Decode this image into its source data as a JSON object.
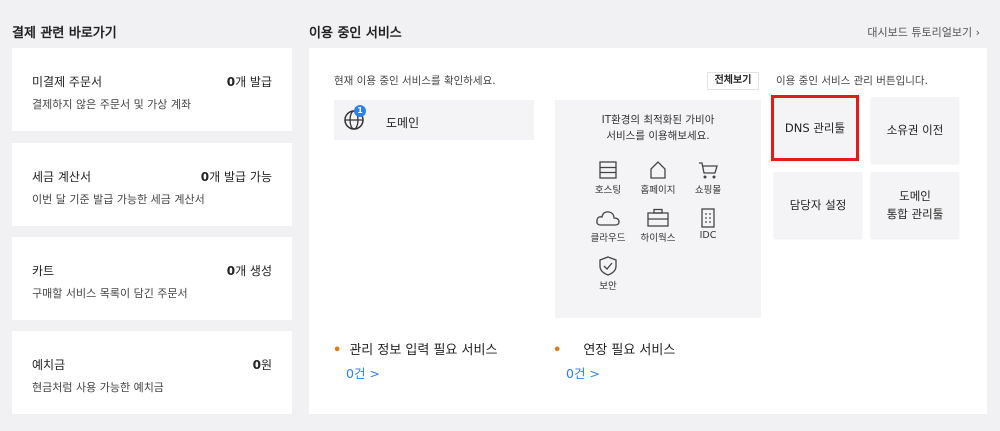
{
  "payment": {
    "title": "결제 관련 바로가기",
    "cards": [
      {
        "title": "미결제 주문서",
        "count": "0",
        "unit": "개 발급",
        "desc": "결제하지 않은 주문서 및 가상 계좌"
      },
      {
        "title": "세금 계산서",
        "count": "0",
        "unit": "개 발급 가능",
        "desc": "이번 달 기준 발급 가능한 세금 계산서"
      },
      {
        "title": "카트",
        "count": "0",
        "unit": "개 생성",
        "desc": "구매할 서비스 목록이 담긴 주문서"
      },
      {
        "title": "예치금",
        "count": "0",
        "unit": "원",
        "desc": "현금처럼 사용 가능한 예치금"
      }
    ]
  },
  "services": {
    "title": "이용 중인 서비스",
    "tutorial_link": "대시보드 튜토리얼보기",
    "desc": "현재 이용 중인 서비스를 확인하세요.",
    "view_all": "전체보기",
    "domain_label": "도메인",
    "domain_badge": "1",
    "recommend_line1": "IT환경의 최적화된 가비아",
    "recommend_line2": "서비스를 이용해보세요.",
    "recommend_items": [
      {
        "label": "호스팅",
        "icon": "hosting-icon"
      },
      {
        "label": "홈페이지",
        "icon": "homepage-icon"
      },
      {
        "label": "쇼핑몰",
        "icon": "cart-icon"
      },
      {
        "label": "클라우드",
        "icon": "cloud-icon"
      },
      {
        "label": "하이웍스",
        "icon": "briefcase-icon"
      },
      {
        "label": "IDC",
        "icon": "building-icon"
      },
      {
        "label": "보안",
        "icon": "shield-icon"
      }
    ],
    "manage_desc": "이용 중인 서비스 관리 버튼입니다.",
    "manage_buttons": {
      "dns": "DNS 관리툴",
      "transfer": "소유권 이전",
      "contact": "담당자 설정",
      "domain_tool_line1": "도메인",
      "domain_tool_line2": "통합 관리툴"
    },
    "stats": {
      "info_label": "관리 정보 입력 필요 서비스",
      "info_count": "0건 >",
      "renew_label": "연장 필요 서비스",
      "renew_count": "0건 >"
    }
  },
  "colors": {
    "accent": "#2b7ff0",
    "highlight": "#e21b1b",
    "bullet": "#e07b16"
  }
}
